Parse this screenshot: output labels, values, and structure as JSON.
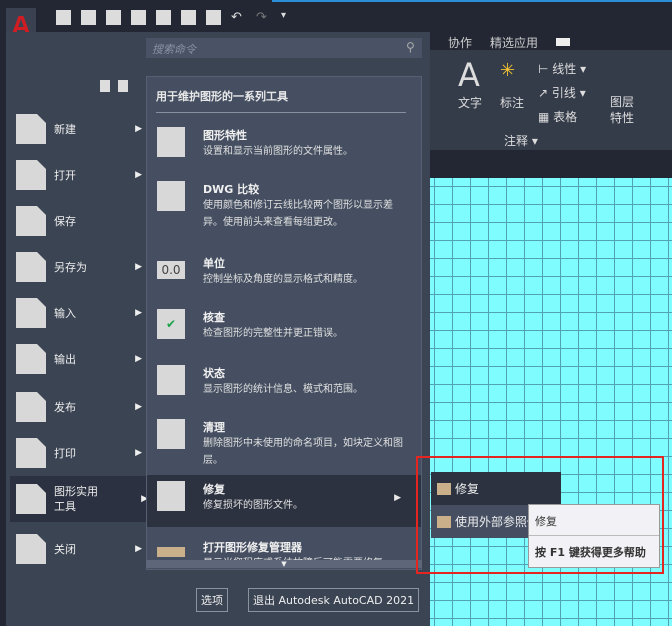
{
  "quick_access": [
    "new-icon",
    "open-icon",
    "save-icon",
    "save-as-icon",
    "open-from-mobile-icon",
    "share-icon",
    "print-icon",
    "undo-icon",
    "redo-icon",
    "customize-icon"
  ],
  "ribbon": {
    "tabs": [
      "协作",
      "精选应用"
    ],
    "text": "文字",
    "dim": "标注",
    "linear": "线性",
    "leader": "引线",
    "table": "表格",
    "panel": "注释",
    "layer": "图层\n特性"
  },
  "search": {
    "placeholder": "搜索命令"
  },
  "left_menu": [
    {
      "label": "新建"
    },
    {
      "label": "打开"
    },
    {
      "label": "保存"
    },
    {
      "label": "另存为"
    },
    {
      "label": "输入"
    },
    {
      "label": "输出"
    },
    {
      "label": "发布"
    },
    {
      "label": "打印"
    },
    {
      "label": "图形实用工具"
    },
    {
      "label": "关闭"
    }
  ],
  "submenu": {
    "header": "用于维护图形的一系列工具",
    "items": [
      {
        "title": "图形特性",
        "desc": "设置和显示当前图形的文件属性。"
      },
      {
        "title": "DWG 比较",
        "desc": "使用颜色和修订云线比较两个图形以显示差异。使用前头来查看每组更改。"
      },
      {
        "title": "单位",
        "desc": "控制坐标及角度的显示格式和精度。",
        "icon_text": "0.0"
      },
      {
        "title": "核查",
        "desc": "检查图形的完整性并更正错误。"
      },
      {
        "title": "状态",
        "desc": "显示图形的统计信息、模式和范围。"
      },
      {
        "title": "清理",
        "desc": "删除图形中未使用的命名项目，如块定义和图层。"
      },
      {
        "title": "修复",
        "desc": "修复损坏的图形文件。"
      },
      {
        "title": "打开图形修复管理器",
        "desc": "显示当您程序或系统故障后可能需要修复"
      }
    ]
  },
  "footer": {
    "options": "选项",
    "exit": "退出 Autodesk AutoCAD 2021"
  },
  "flyout": {
    "items": [
      "修复",
      "使用外部参照修"
    ]
  },
  "tooltip": {
    "title": "修复",
    "help": "按 F1 键获得更多帮助"
  }
}
